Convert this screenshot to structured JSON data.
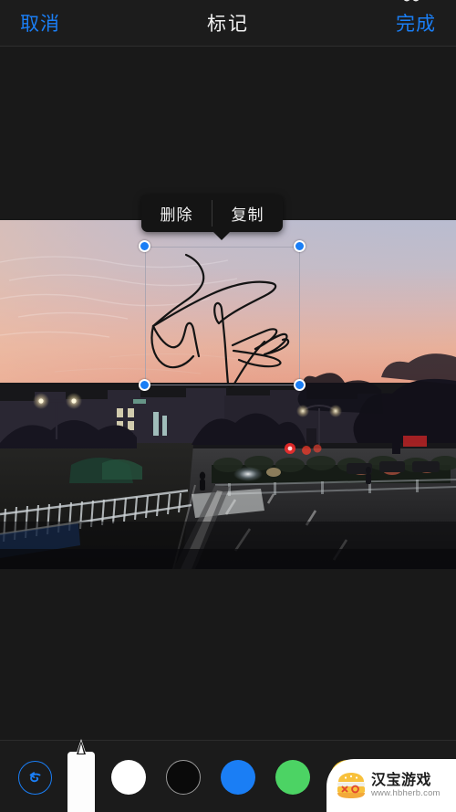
{
  "topbar": {
    "cancel_label": "取消",
    "title": "标记",
    "done_label": "完成",
    "accent_color": "#1a7ef5",
    "title_color": "#f2f2f2"
  },
  "context_menu": {
    "items": [
      {
        "label": "删除",
        "name": "delete"
      },
      {
        "label": "复制",
        "name": "copy"
      }
    ],
    "background": "#141414"
  },
  "canvas": {
    "photo_alt": "黄昏城市街景照片",
    "selection": {
      "handle_color": "#1a7ef5",
      "handle_border": "#ffffff",
      "border_color": "rgba(160,160,175,0.75)",
      "annotation": "手写签名涂鸦",
      "stroke_color": "#111111"
    }
  },
  "toolbar": {
    "undo_label": "撤销",
    "undo_color": "#1a7ef5",
    "pen_label": "记号笔",
    "pen_selected": true,
    "colors": [
      {
        "name": "white",
        "hex": "#ffffff",
        "selected": false,
        "ring": false
      },
      {
        "name": "black",
        "hex": "#0a0a0a",
        "selected": true,
        "ring": true
      },
      {
        "name": "blue",
        "hex": "#1a7ef5",
        "selected": false,
        "ring": false
      },
      {
        "name": "green",
        "hex": "#4cd364",
        "selected": false,
        "ring": false
      },
      {
        "name": "yellow",
        "hex": "#fdc82a",
        "selected": false,
        "ring": false
      },
      {
        "name": "red",
        "hex": "#f7344a",
        "selected": false,
        "ring": false
      }
    ]
  },
  "watermark": {
    "brand": "汉宝游戏",
    "url": "www.hbherb.com"
  }
}
